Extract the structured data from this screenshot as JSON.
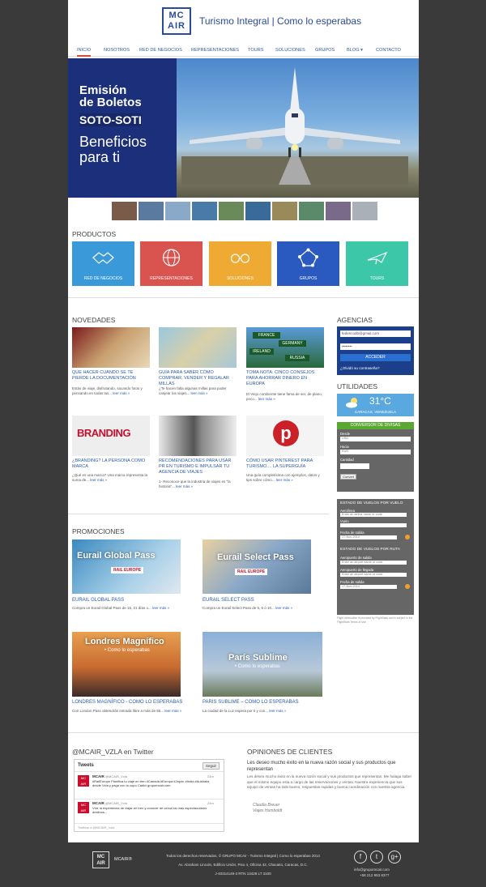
{
  "brand": {
    "logo_line1": "MC",
    "logo_line2": "AIR",
    "tagline": "Turismo Integral | Como lo esperabas"
  },
  "nav": [
    "INICIO",
    "NOSOTROS",
    "RED DE NEGOCIOS",
    "REPRESENTACIONES",
    "TOURS",
    "SOLUCIONES",
    "GRUPOS",
    "BLOG ▾",
    "CONTACTO"
  ],
  "hero": {
    "line1": "Emisión",
    "line2": "de Boletos",
    "line3": "SOTO-SOTI",
    "line4": "Beneficios",
    "line5": "para ti"
  },
  "products": {
    "title": "PRODUCTOS",
    "items": [
      {
        "label": "RED DE NEGOCIOS",
        "color": "#3a9ad9",
        "icon": "handshake-icon"
      },
      {
        "label": "REPRESENTACIONES",
        "color": "#d9534f",
        "icon": "globe-icon"
      },
      {
        "label": "SOLUCIONES",
        "color": "#eeaa33",
        "icon": "glasses-icon"
      },
      {
        "label": "GRUPOS",
        "color": "#2a5ac0",
        "icon": "network-icon"
      },
      {
        "label": "TOURS",
        "color": "#3cc8a8",
        "icon": "plane-icon"
      }
    ]
  },
  "news": {
    "title": "NOVEDADES",
    "more": "leer más »",
    "items": [
      {
        "title": "QUE HACER CUANDO SE TE PIERDE LA DOCUMENTACIÓN",
        "text": "Estás de viaje, disfrutando, sacando fotos y pensando en todas las..."
      },
      {
        "title": "GUÍA PARA SABER CÓMO COMPRAR, VENDER Y REGALAR MILLAS",
        "text": "¿Te hacen falta algunas millas para poder canjear los viajes..."
      },
      {
        "title": "TOMA NOTA: CINCO CONSEJOS PARA AHORRAR DINERO EN EUROPA",
        "text": "El Viejo continente tiene fama de ser, de plano, poco..."
      },
      {
        "title": "¿BRANDING? LA PERSONA COMO MARCA",
        "text": "¿Qué es una marca? Una marca representa la suma de..."
      },
      {
        "title": "RECOMENDACIONES PARA USAR PR EN TURISMO E IMPULSAR TU AGENCIA DE VIAJES",
        "text": "1- Reconoce que la industria de viajes es \"la historia\"..."
      },
      {
        "title": "CÓMO USAR PINTEREST PARA TURISMO.... LA SUPERGUÍA",
        "text": "Una guía completísima con ejemplos, datos y tips sobre cómo..."
      }
    ]
  },
  "agencias": {
    "title": "AGENCIAS",
    "email": "fedencodb@gmail.com",
    "password": "••••••••",
    "button": "ACCEDER",
    "forgot": "¿Olvidó su contraseña?"
  },
  "utilidades": {
    "title": "UTILIDADES",
    "temp": "31°C",
    "city": "CARACAS, VENEZUELA"
  },
  "converter": {
    "title": "CONVERSOR DE DIVISAS",
    "from_label": "Desde",
    "from": "USD",
    "to_label": "Hacia",
    "to": "EUR",
    "amount_label": "Cantidad",
    "button": "Convert"
  },
  "flight_status": {
    "title1": "ESTADO DE VUELOS POR VUELO",
    "airline_label": "Aerolínea",
    "airline_ph": "Enter an airline name or code",
    "flight_label": "Vuelo",
    "date_label": "Fecha de salida",
    "date": "17-Nov-2014",
    "title2": "ESTADO DE VUELOS POR RUTA",
    "dep_label": "Aeropuerto de salida",
    "dep_ph": "Enter an airport name or code",
    "arr_label": "Aeropuerto de llegada",
    "arr_ph": "Enter an airport name or code",
    "date2_label": "Fecha de salida",
    "date2": "17-Nov-2014",
    "credit": "Flight information is provided by FlightStats and is subject to the FlightStats Terms of Use"
  },
  "promos": {
    "title": "PROMOCIONES",
    "more": "leer más »",
    "items": [
      {
        "overlay": "Eurail Global Pass",
        "badge": "RAIL EUROPE",
        "title": "EURAIL GLOBAL PASS",
        "text": "Compra un Eurail Global Pass de 15, 21 días o..."
      },
      {
        "overlay": "Eurail Select Pass",
        "badge": "RAIL EUROPE",
        "title": "EURAIL SELECT PASS",
        "text": "Compra un Eurail Select Pass de 5, 6 ó 10..."
      },
      {
        "overlay": "Londres Magnífico",
        "sub": "• Como lo esperabas",
        "title": "LONDRES MAGNÍFICO - COMO LO ESPERABAS",
        "text": "Con London Pass obtendrás entrada libre a más de 55..."
      },
      {
        "overlay": "París Sublime",
        "sub": "• Como lo esperabas",
        "title": "PARIS SUBLIME – COMO LO ESPERABAS",
        "text": "La ciudad de la Luz espera por ti y con..."
      }
    ]
  },
  "twitter": {
    "title": "@MCAIR_VZLA en Twitter",
    "tweets_label": "Tweets",
    "follow": "Seguir",
    "tweet1_name": "MCAIR",
    "tweet1_handle": "@MCAIR_Vzla",
    "tweet1_time": "24m",
    "tweet1_text": "#RailEurope Planifica tu viaje en tren #Canadá #Europa #Japón #India #Australia desde Vzla y paga con tu cupo Cadivi grupomcair.com",
    "tweet2_name": "MCAIR",
    "tweet2_handle": "@MCAIR_Vzla",
    "tweet2_time": "24m",
    "tweet2_text": "Vivir la experiencia de viajar en tren y conocer de cerca los mas espectaculares destinos...",
    "compose_ph": "Twittear a @MCAIR_Vzla"
  },
  "opinions": {
    "title": "OPINIONES DE CLIENTES",
    "headline": "Les deseo mucho éxito en la nueva razón social y sus productos que representan",
    "body": "Les deseo mucho éxito en la nueva razón social y sus productos que representan. Me halaga saber que el mismo equipo esta a cargo de las reservaciones y ventas. Nuestra experiencia que sus equipo de ventas ha sido bueno, respuestas rapidas y buena coordinación con nuestra agencia.",
    "author": "Claudia Breuer",
    "company": "Viajes Humboldt"
  },
  "footer": {
    "logo_line1": "MC",
    "logo_line2": "AIR",
    "brand": "MCAIR®",
    "line1": "Todos los derechos reservados, © GRUPO MCAir - Turismo Integral | Como lo esperabas 2014",
    "line2": "Av. Abraham Lincoln, Edificio Unión, Piso 4, Oficina 42, Chacaito, Caracas, D.C.",
    "line3": "J-40314149-3     RTN 13428     LT 3100",
    "email": "info@grupomcair.com",
    "phone": "+58 212 953 8377"
  }
}
